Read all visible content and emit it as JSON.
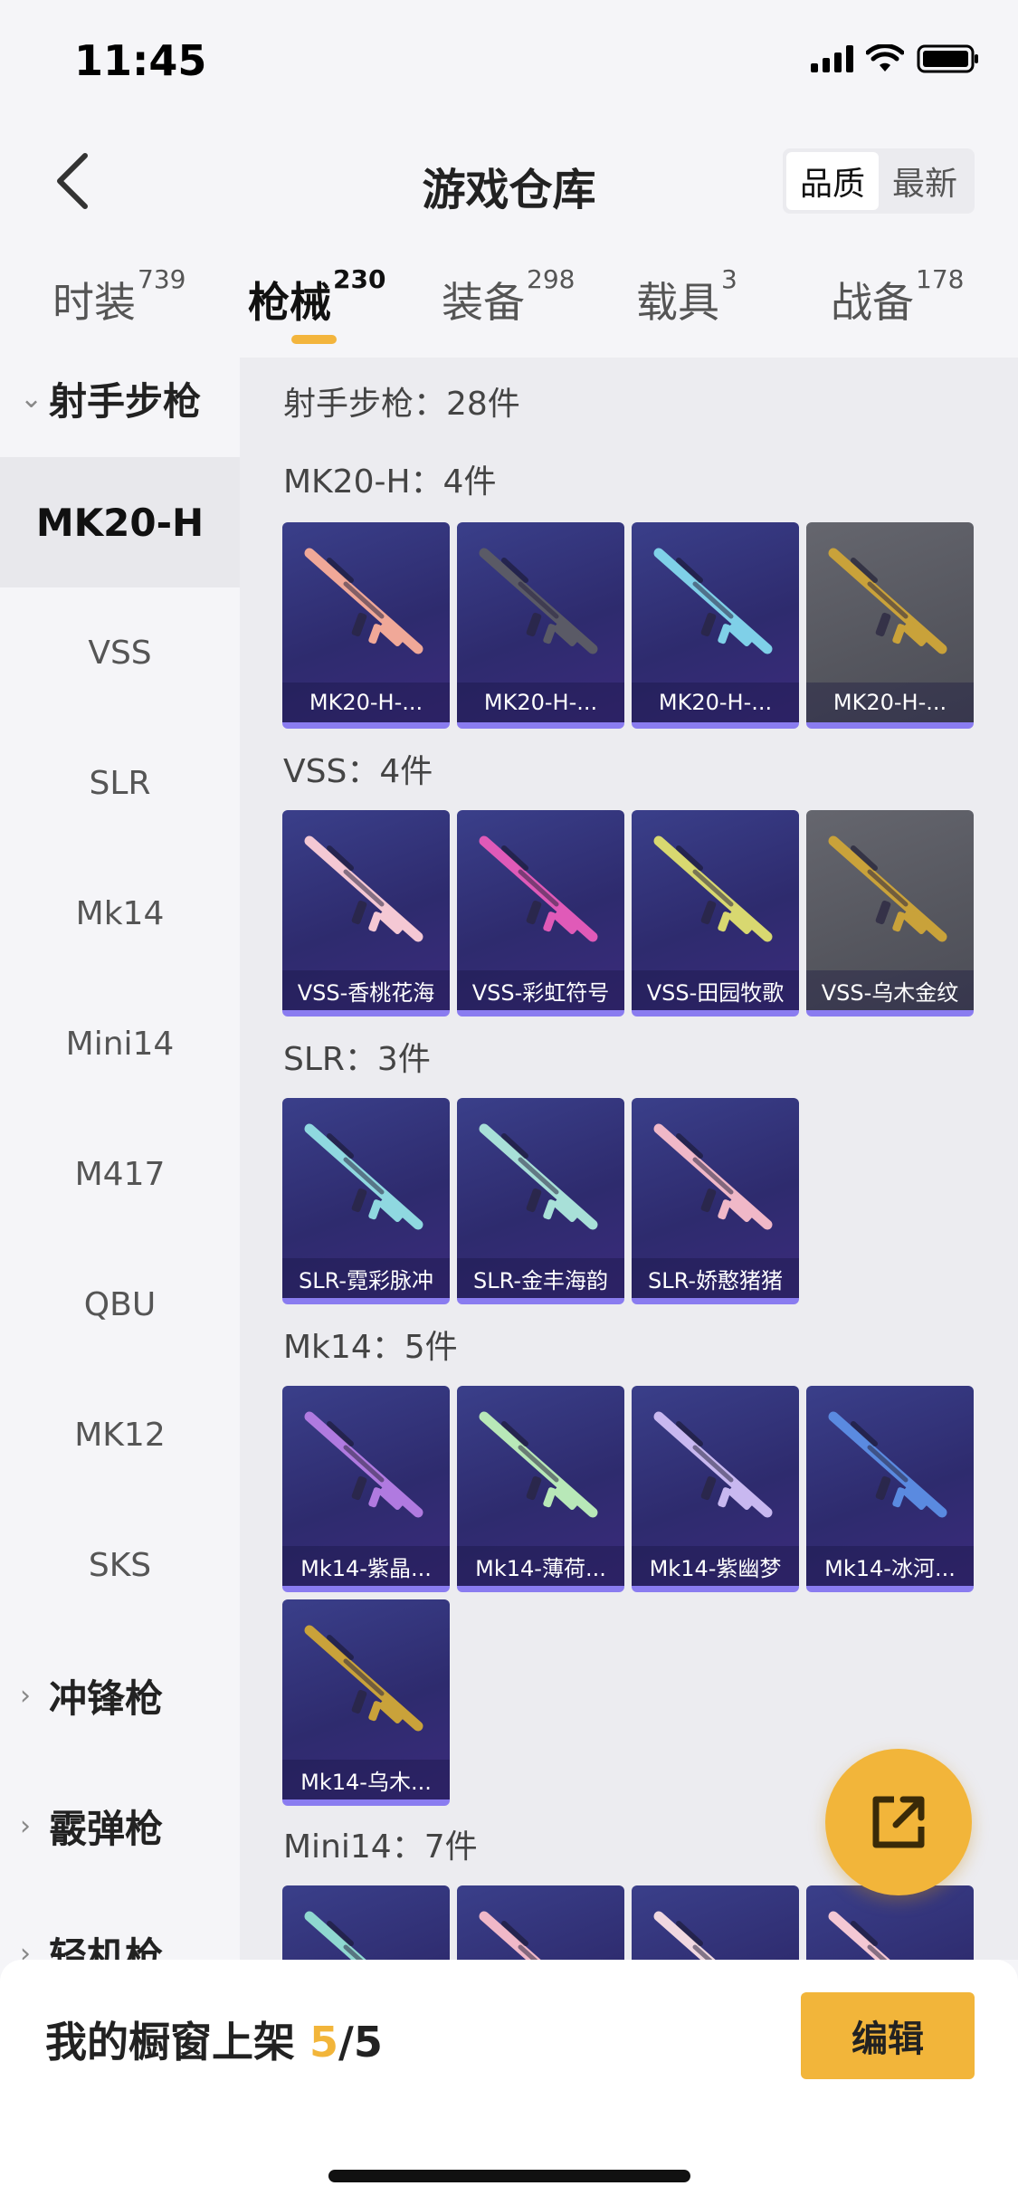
{
  "status_bar": {
    "time": "11:45"
  },
  "header": {
    "title": "游戏仓库",
    "sort_options": [
      "品质",
      "最新"
    ],
    "sort_selected": "品质"
  },
  "tabs": [
    {
      "label": "时装",
      "count": "739"
    },
    {
      "label": "枪械",
      "count": "230"
    },
    {
      "label": "装备",
      "count": "298"
    },
    {
      "label": "载具",
      "count": "3"
    },
    {
      "label": "战备",
      "count": "178"
    }
  ],
  "active_tab": "枪械",
  "sidebar": {
    "groups": [
      {
        "label": "射手步枪",
        "expanded": true
      },
      {
        "label": "冲锋枪",
        "expanded": false
      },
      {
        "label": "霰弹枪",
        "expanded": false
      },
      {
        "label": "轻机枪",
        "expanded": false
      }
    ],
    "items": [
      "MK20-H",
      "VSS",
      "SLR",
      "Mk14",
      "Mini14",
      "M417",
      "QBU",
      "MK12",
      "SKS"
    ],
    "selected_item": "MK20-H"
  },
  "content": {
    "category_summary": "射手步枪：28件",
    "sections": [
      {
        "title": "MK20-H：4件",
        "items": [
          {
            "name": "MK20-H-...",
            "tier": "purple",
            "color": "#f0a898"
          },
          {
            "name": "MK20-H-...",
            "tier": "purple",
            "color": "#5a5a66"
          },
          {
            "name": "MK20-H-...",
            "tier": "purple",
            "color": "#7fd0e8"
          },
          {
            "name": "MK20-H-...",
            "tier": "grey",
            "color": "#c9a23a"
          }
        ]
      },
      {
        "title": "VSS：4件",
        "items": [
          {
            "name": "VSS-香桃花海",
            "tier": "purple",
            "color": "#f4c8d4"
          },
          {
            "name": "VSS-彩虹符号",
            "tier": "purple",
            "color": "#e05ab8"
          },
          {
            "name": "VSS-田园牧歌",
            "tier": "purple",
            "color": "#d8d870"
          },
          {
            "name": "VSS-乌木金纹",
            "tier": "grey",
            "color": "#c9a23a"
          }
        ]
      },
      {
        "title": "SLR：3件",
        "items": [
          {
            "name": "SLR-霓彩脉冲",
            "tier": "purple",
            "color": "#8fd8e0"
          },
          {
            "name": "SLR-金丰海韵",
            "tier": "purple",
            "color": "#a8e0d8"
          },
          {
            "name": "SLR-娇憨猪猪",
            "tier": "purple",
            "color": "#f0b8c8"
          }
        ]
      },
      {
        "title": "Mk14：5件",
        "items": [
          {
            "name": "Mk14-紫晶...",
            "tier": "purple",
            "color": "#b07ae0"
          },
          {
            "name": "Mk14-薄荷...",
            "tier": "purple",
            "color": "#b8e8b8"
          },
          {
            "name": "Mk14-紫幽梦",
            "tier": "purple",
            "color": "#c8b8f0"
          },
          {
            "name": "Mk14-冰河...",
            "tier": "purple",
            "color": "#5a8ae0"
          },
          {
            "name": "Mk14-乌木...",
            "tier": "purple",
            "color": "#c9a23a"
          }
        ]
      },
      {
        "title": "Mini14：7件",
        "items": [
          {
            "name": "",
            "tier": "purple",
            "color": "#8fd8d0"
          },
          {
            "name": "",
            "tier": "purple",
            "color": "#f0b8c8"
          },
          {
            "name": "",
            "tier": "purple",
            "color": "#f0d8e0"
          },
          {
            "name": "",
            "tier": "purple",
            "color": "#f4c8d4"
          }
        ]
      }
    ]
  },
  "bottom_bar": {
    "showcase_label": "我的橱窗上架 ",
    "showcase_current": "5",
    "showcase_total": "/5",
    "edit_label": "编辑"
  },
  "colors": {
    "accent": "#f2b53a",
    "card_purple": "#2e2b6e",
    "card_grey": "#55565e"
  }
}
